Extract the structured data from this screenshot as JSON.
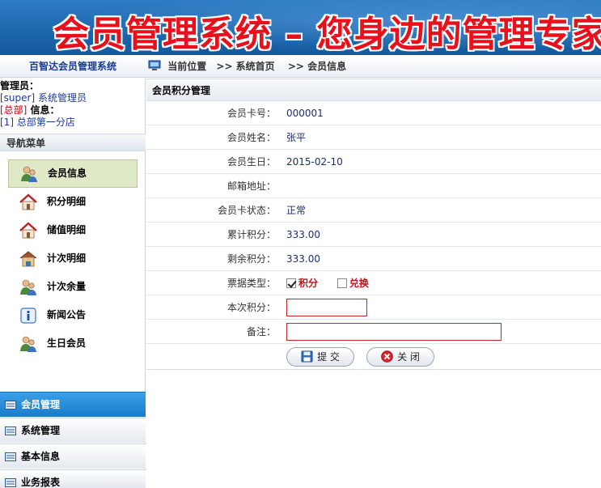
{
  "banner": {
    "title": "会员管理系统 – 您身边的管理专家"
  },
  "topbar": {
    "system_name": "百智达会员管理系统",
    "location_label": "当前位置",
    "crumbs": [
      ">> 系统首页",
      ">> 会员信息"
    ]
  },
  "admin": {
    "admin_label": "管理员：",
    "admin_value": "[super] 系统管理员",
    "branch_tag": "[总部]",
    "info_label": " 信息：",
    "branch_value": "[1] 总部第一分店"
  },
  "nav": {
    "title": "导航菜单",
    "items": [
      {
        "label": "会员信息",
        "icon": "member-icon",
        "active": true
      },
      {
        "label": "积分明细",
        "icon": "house-icon",
        "active": false
      },
      {
        "label": "储值明细",
        "icon": "house-icon",
        "active": false
      },
      {
        "label": "计次明细",
        "icon": "house-person-icon",
        "active": false
      },
      {
        "label": "计次余量",
        "icon": "member-icon",
        "active": false
      },
      {
        "label": "新闻公告",
        "icon": "info-icon",
        "active": false
      },
      {
        "label": "生日会员",
        "icon": "member-icon",
        "active": false
      }
    ]
  },
  "sections": [
    {
      "label": "会员管理",
      "active": true
    },
    {
      "label": "系统管理",
      "active": false
    },
    {
      "label": "基本信息",
      "active": false
    },
    {
      "label": "业务报表",
      "active": false
    }
  ],
  "panel": {
    "title": "会员积分管理",
    "fields": {
      "card_no": {
        "label": "会员卡号：",
        "value": "000001"
      },
      "name": {
        "label": "会员姓名：",
        "value": "张平"
      },
      "birthday": {
        "label": "会员生日：",
        "value": "2015-02-10"
      },
      "email": {
        "label": "邮箱地址：",
        "value": ""
      },
      "status": {
        "label": "会员卡状态：",
        "value": "正常"
      },
      "total_points": {
        "label": "累计积分：",
        "value": "333.00"
      },
      "remain_points": {
        "label": "剩余积分：",
        "value": "333.00"
      },
      "ticket_type": {
        "label": "票据类型：",
        "options": [
          "积分",
          "兑换"
        ],
        "checked": [
          true,
          false
        ]
      },
      "current_points": {
        "label": "本次积分：",
        "value": ""
      },
      "remark": {
        "label": "备注：",
        "value": ""
      }
    },
    "buttons": {
      "submit": "提 交",
      "close": "关 闭"
    }
  },
  "colors": {
    "accent": "#1f68b0",
    "title_red": "#e8101a",
    "input_border": "#c9252c"
  }
}
